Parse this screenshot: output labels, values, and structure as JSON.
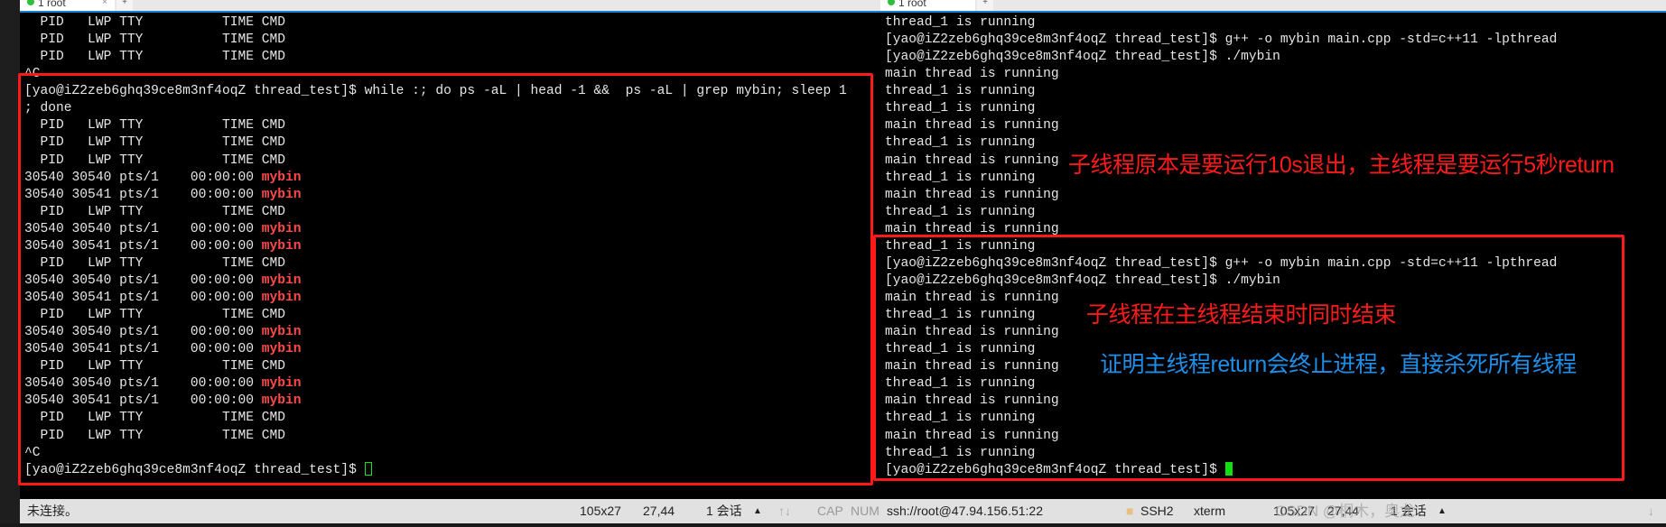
{
  "left": {
    "tab_label": "1 root",
    "tab_close": "×",
    "tab_add": "+",
    "lines": [
      {
        "t": "  PID   LWP TTY          TIME CMD"
      },
      {
        "t": "  PID   LWP TTY          TIME CMD"
      },
      {
        "t": "  PID   LWP TTY          TIME CMD"
      },
      {
        "t": "^C"
      },
      {
        "t": "[yao@iZ2zeb6ghq39ce8m3nf4oqZ thread_test]$ while :; do ps -aL | head -1 &&  ps -aL | grep mybin; sleep 1"
      },
      {
        "t": "; done"
      },
      {
        "t": "  PID   LWP TTY          TIME CMD"
      },
      {
        "t": "  PID   LWP TTY          TIME CMD"
      },
      {
        "t": "  PID   LWP TTY          TIME CMD"
      },
      {
        "t": "30540 30540 pts/1    00:00:00 ",
        "r": "mybin"
      },
      {
        "t": "30540 30541 pts/1    00:00:00 ",
        "r": "mybin"
      },
      {
        "t": "  PID   LWP TTY          TIME CMD"
      },
      {
        "t": "30540 30540 pts/1    00:00:00 ",
        "r": "mybin"
      },
      {
        "t": "30540 30541 pts/1    00:00:00 ",
        "r": "mybin"
      },
      {
        "t": "  PID   LWP TTY          TIME CMD"
      },
      {
        "t": "30540 30540 pts/1    00:00:00 ",
        "r": "mybin"
      },
      {
        "t": "30540 30541 pts/1    00:00:00 ",
        "r": "mybin"
      },
      {
        "t": "  PID   LWP TTY          TIME CMD"
      },
      {
        "t": "30540 30540 pts/1    00:00:00 ",
        "r": "mybin"
      },
      {
        "t": "30540 30541 pts/1    00:00:00 ",
        "r": "mybin"
      },
      {
        "t": "  PID   LWP TTY          TIME CMD"
      },
      {
        "t": "30540 30540 pts/1    00:00:00 ",
        "r": "mybin"
      },
      {
        "t": "30540 30541 pts/1    00:00:00 ",
        "r": "mybin"
      },
      {
        "t": "  PID   LWP TTY          TIME CMD"
      },
      {
        "t": "  PID   LWP TTY          TIME CMD"
      },
      {
        "t": "^C"
      },
      {
        "t": "[yao@iZ2zeb6ghq39ce8m3nf4oqZ thread_test]$ ",
        "cursor": "outline"
      }
    ],
    "status": {
      "connection": "未连接。",
      "size": "105x27",
      "position": "27,44",
      "sessions": "1 会话",
      "up_arrow": "▲",
      "nav_arrows": "↑↓",
      "cap": "CAP",
      "num": "NUM"
    }
  },
  "right": {
    "tab_label": "1 root",
    "tab_add": "+",
    "lines": [
      {
        "t": "thread_1 is running"
      },
      {
        "t": "[yao@iZ2zeb6ghq39ce8m3nf4oqZ thread_test]$ g++ -o mybin main.cpp -std=c++11 -lpthread"
      },
      {
        "t": "[yao@iZ2zeb6ghq39ce8m3nf4oqZ thread_test]$ ./mybin"
      },
      {
        "t": "main thread is running"
      },
      {
        "t": "thread_1 is running"
      },
      {
        "t": "thread_1 is running"
      },
      {
        "t": "main thread is running"
      },
      {
        "t": "thread_1 is running"
      },
      {
        "t": "main thread is running"
      },
      {
        "t": "thread_1 is running"
      },
      {
        "t": "main thread is running"
      },
      {
        "t": "thread_1 is running"
      },
      {
        "t": "main thread is running"
      },
      {
        "t": "thread_1 is running"
      },
      {
        "t": "[yao@iZ2zeb6ghq39ce8m3nf4oqZ thread_test]$ g++ -o mybin main.cpp -std=c++11 -lpthread"
      },
      {
        "t": "[yao@iZ2zeb6ghq39ce8m3nf4oqZ thread_test]$ ./mybin"
      },
      {
        "t": "main thread is running"
      },
      {
        "t": "thread_1 is running"
      },
      {
        "t": "main thread is running"
      },
      {
        "t": "thread_1 is running"
      },
      {
        "t": "main thread is running"
      },
      {
        "t": "thread_1 is running"
      },
      {
        "t": "main thread is running"
      },
      {
        "t": "thread_1 is running"
      },
      {
        "t": "main thread is running"
      },
      {
        "t": "thread_1 is running"
      },
      {
        "t": "[yao@iZ2zeb6ghq39ce8m3nf4oqZ thread_test]$ ",
        "cursor": "block"
      }
    ],
    "status": {
      "connection": "ssh://root@47.94.156.51:22",
      "protocol": "SSH2",
      "terminal_type": "xterm",
      "size": "105x27",
      "position": "27,44",
      "sessions": "1 会话",
      "up_arrow": "▲",
      "down_arrow": "↓"
    }
  },
  "annotations": {
    "note1": "子线程原本是要运行10s退出，主线程是要运行5秒return",
    "note2": "子线程在主线程结束时同时结束",
    "note3": "证明主线程return会终止进程，直接杀死所有线程",
    "note1_color": "#ff1a1a",
    "note2_color": "#ff1a1a",
    "note3_color": "#1e8fe8",
    "box_color": "#ff1a1a"
  },
  "watermark": "CSDN @桐木，奥龙",
  "colors": {
    "highlight": "#ff4a4a",
    "cursor": "#10e010",
    "tab_accent": "#1a7fd4"
  }
}
